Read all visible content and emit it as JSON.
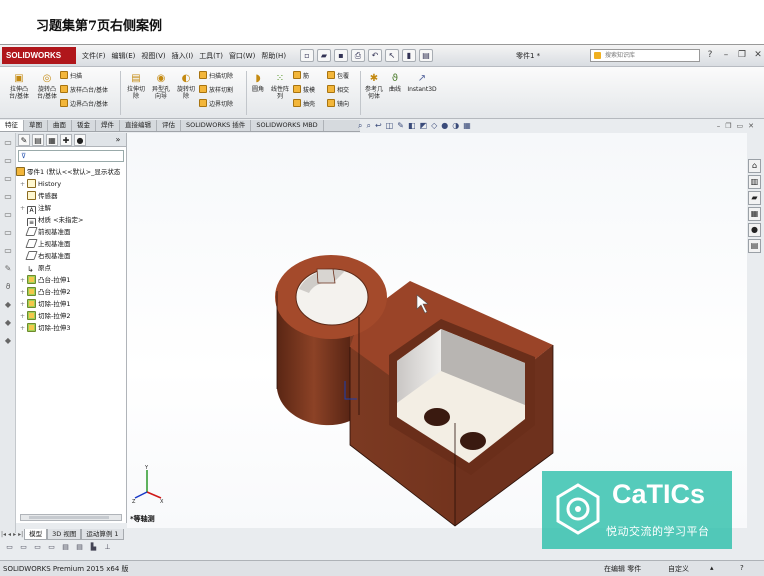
{
  "slide": {
    "title": "习题集第7页右侧案例"
  },
  "app": {
    "logo": "SOLIDWORKS",
    "menus": [
      "文件(F)",
      "编辑(E)",
      "视图(V)",
      "插入(I)",
      "工具(T)",
      "窗口(W)",
      "帮助(H)"
    ],
    "document_name": "零件1 *",
    "search_placeholder": "搜索知识库",
    "help_icon": "?"
  },
  "ribbon": {
    "extrude_boss": "拉伸凸\n台/基体",
    "revolve_boss": "旋转凸\n台/基体",
    "sweep": "扫描",
    "loft": "放样凸台/基体",
    "boundary_boss": "边界凸台/基体",
    "extrude_cut": "拉伸切\n除",
    "hole_wizard": "异型孔\n向导",
    "revolve_cut": "旋转切\n除",
    "swept_cut": "扫描切除",
    "lofted_cut": "放样切割",
    "boundary_cut": "边界切除",
    "fillet": "圆角",
    "linear_pattern": "线性阵\n列",
    "rib": "筋",
    "draft": "拔模",
    "shell": "抽壳",
    "wrap": "包覆",
    "intersect": "相交",
    "mirror": "镜向",
    "ref_geometry": "参考几\n何体",
    "curves": "曲线",
    "instant3d": "Instant3D"
  },
  "command_tabs": [
    "特征",
    "草图",
    "曲面",
    "钣金",
    "焊件",
    "直接编辑",
    "评估",
    "SOLIDWORKS 插件",
    "SOLIDWORKS MBD"
  ],
  "feature_tree": {
    "root": "零件1  (默认<<默认>_显示状态",
    "items": [
      {
        "label": "History",
        "icon": "history-icon",
        "expand": "+"
      },
      {
        "label": "传感器",
        "icon": "sensor-icon",
        "expand": ""
      },
      {
        "label": "注解",
        "icon": "annotation-icon",
        "expand": "+"
      },
      {
        "label": "材质 <未指定>",
        "icon": "material-icon",
        "expand": ""
      },
      {
        "label": "前视基准面",
        "icon": "plane-icon",
        "expand": ""
      },
      {
        "label": "上视基准面",
        "icon": "plane-icon",
        "expand": ""
      },
      {
        "label": "右视基准面",
        "icon": "plane-icon",
        "expand": ""
      },
      {
        "label": "原点",
        "icon": "origin-icon",
        "expand": ""
      },
      {
        "label": "凸台-拉伸1",
        "icon": "extrude-icon",
        "expand": "+"
      },
      {
        "label": "凸台-拉伸2",
        "icon": "extrude-icon",
        "expand": "+"
      },
      {
        "label": "切除-拉伸1",
        "icon": "cut-icon",
        "expand": "+"
      },
      {
        "label": "切除-拉伸2",
        "icon": "cut-icon",
        "expand": "+"
      },
      {
        "label": "切除-拉伸3",
        "icon": "cut-icon",
        "expand": "+"
      }
    ],
    "more": "»"
  },
  "bottom_tabs": [
    "模型",
    "3D 视图",
    "运动算例 1"
  ],
  "viewport": {
    "view_label": "*等轴测"
  },
  "status": {
    "product": "SOLIDWORKS Premium 2015 x64 版",
    "mode": "在编辑 零件",
    "units": "自定义"
  },
  "watermark": {
    "brand": "CaTICs",
    "tagline": "悦动交流的学习平台"
  },
  "colors": {
    "model_face": "#7a3a22",
    "model_top": "#a0492b",
    "pocket_floor": "#f3eee4",
    "brand_red": "#b0161b",
    "watermark": "#26bea8"
  }
}
